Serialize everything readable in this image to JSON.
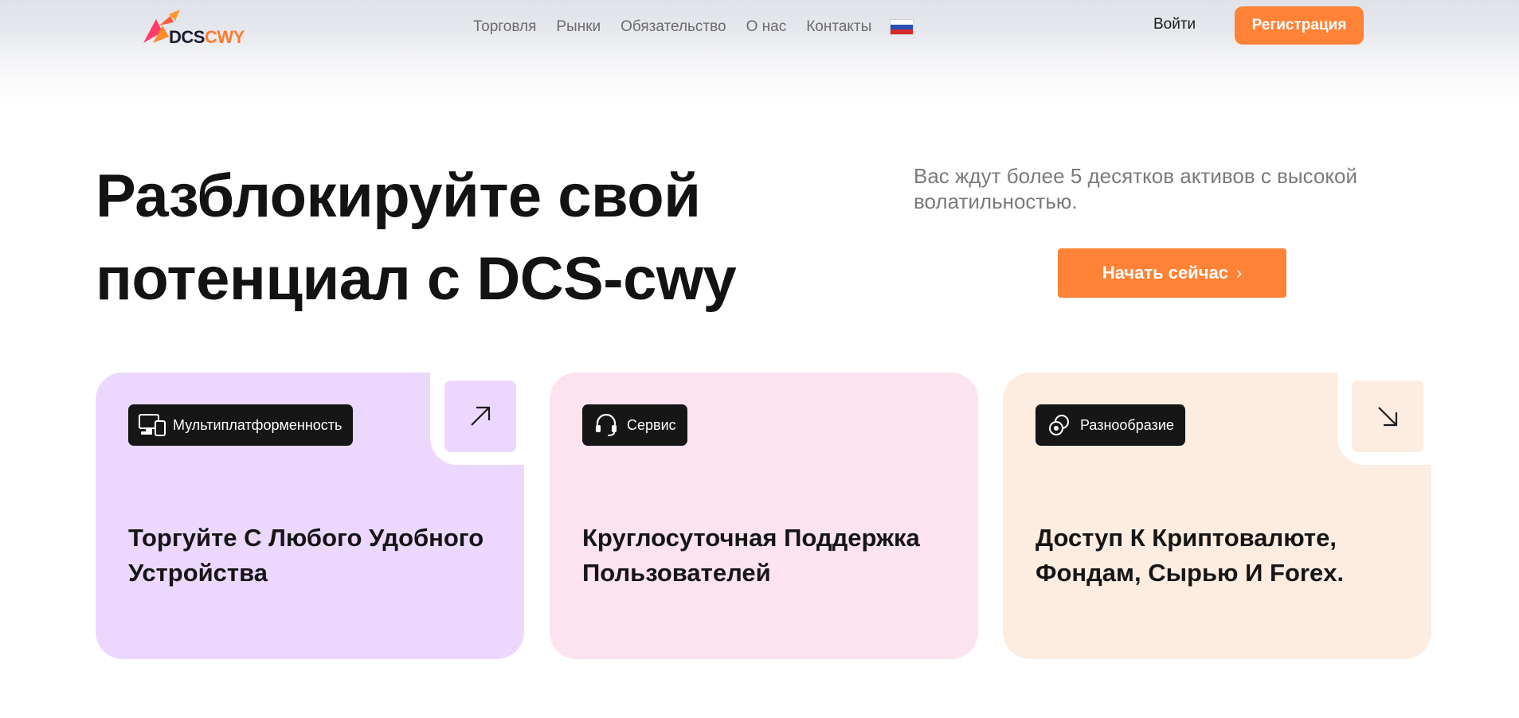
{
  "brand": {
    "logo_part1": "DCS",
    "logo_part2": "CWY"
  },
  "nav": {
    "items": [
      {
        "label": "Торговля"
      },
      {
        "label": "Рынки"
      },
      {
        "label": "Обязательство"
      },
      {
        "label": "О нас"
      },
      {
        "label": "Контакты"
      }
    ],
    "language_flag": "russia-flag-icon"
  },
  "auth": {
    "login_label": "Войти",
    "register_label": "Регистрация"
  },
  "hero": {
    "title_line1": "Разблокируйте свой",
    "title_line2": "потенциал с DCS-cwy",
    "subtitle": "Вас ждут более 5 десятков активов с высокой волатильностью.",
    "cta_label": "Начать сейчас",
    "cta_icon": "chevron-right-icon"
  },
  "cards": [
    {
      "tag": "Мультиплатформенность",
      "icon": "devices-icon",
      "title": "Торгуйте С Любого Удобного Устройства",
      "arrow": "arrow-up-right-icon",
      "bg": "#ecd8fe"
    },
    {
      "tag": "Сервис",
      "icon": "headset-icon",
      "title": "Круглосуточная Поддержка Пользователей",
      "bg": "#fde2f0"
    },
    {
      "tag": "Разнообразие",
      "icon": "coins-icon",
      "title": "Доступ К Криптовалюте, Фондам, Сырью И Forex.",
      "arrow": "arrow-down-right-icon",
      "bg": "#fdece0"
    }
  ],
  "colors": {
    "accent": "#ff8236",
    "text": "#151515",
    "muted": "#7a7a7a"
  }
}
